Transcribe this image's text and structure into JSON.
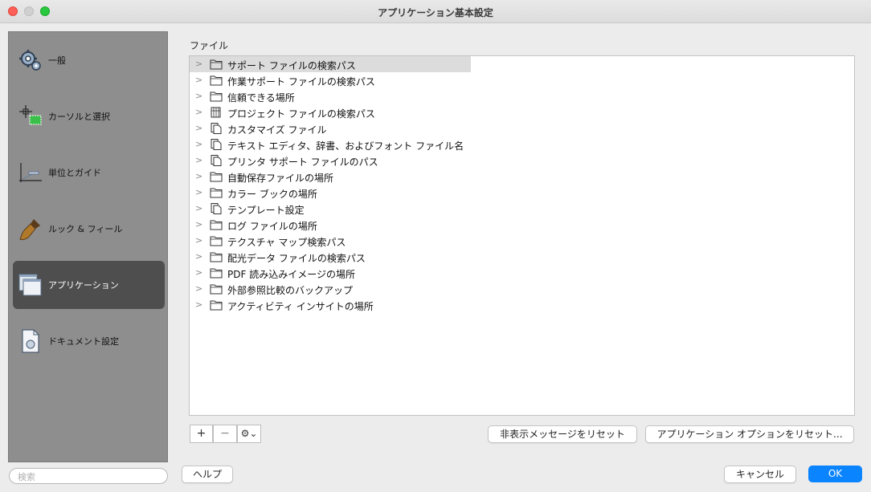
{
  "window": {
    "title": "アプリケーション基本設定"
  },
  "sidebar": {
    "items": [
      {
        "label": "一般",
        "icon": "gears-icon"
      },
      {
        "label": "カーソルと選択",
        "icon": "cursor-select-icon"
      },
      {
        "label": "単位とガイド",
        "icon": "ruler-guide-icon"
      },
      {
        "label": "ルック & フィール",
        "icon": "brush-icon"
      },
      {
        "label": "アプリケーション",
        "icon": "windows-icon",
        "selected": true
      },
      {
        "label": "ドキュメント設定",
        "icon": "document-icon"
      }
    ],
    "search_placeholder": "検索"
  },
  "main": {
    "section_label": "ファイル",
    "tree": [
      {
        "label": "サポート ファイルの検索パス",
        "icon": "folder-icon",
        "selected": true
      },
      {
        "label": "作業サポート ファイルの検索パス",
        "icon": "folder-icon"
      },
      {
        "label": "信頼できる場所",
        "icon": "folder-icon"
      },
      {
        "label": "プロジェクト ファイルの検索パス",
        "icon": "project-files-icon"
      },
      {
        "label": "カスタマイズ ファイル",
        "icon": "files-icon"
      },
      {
        "label": "テキスト エディタ、辞書、およびフォント ファイル名",
        "icon": "files-icon"
      },
      {
        "label": "プリンタ サポート ファイルのパス",
        "icon": "files-icon"
      },
      {
        "label": "自動保存ファイルの場所",
        "icon": "folder-icon"
      },
      {
        "label": "カラー ブックの場所",
        "icon": "folder-icon"
      },
      {
        "label": "テンプレート設定",
        "icon": "files-icon"
      },
      {
        "label": "ログ ファイルの場所",
        "icon": "folder-icon"
      },
      {
        "label": "テクスチャ マップ検索パス",
        "icon": "folder-icon"
      },
      {
        "label": "配光データ ファイルの検索パス",
        "icon": "folder-icon"
      },
      {
        "label": "PDF 読み込みイメージの場所",
        "icon": "folder-icon"
      },
      {
        "label": "外部参照比較のバックアップ",
        "icon": "folder-icon"
      },
      {
        "label": "アクティビティ インサイトの場所",
        "icon": "folder-icon"
      }
    ]
  },
  "toolbar": {
    "add_label": "+",
    "remove_label": "−",
    "gear_label": "⚙⌄"
  },
  "buttons": {
    "reset_hidden": "非表示メッセージをリセット",
    "reset_options": "アプリケーション オプションをリセット...",
    "help": "ヘルプ",
    "cancel": "キャンセル",
    "ok": "OK"
  },
  "colors": {
    "accent": "#0a84ff",
    "sidebar_bg": "#8e8e8e",
    "sidebar_selected": "#4e4e4e"
  }
}
